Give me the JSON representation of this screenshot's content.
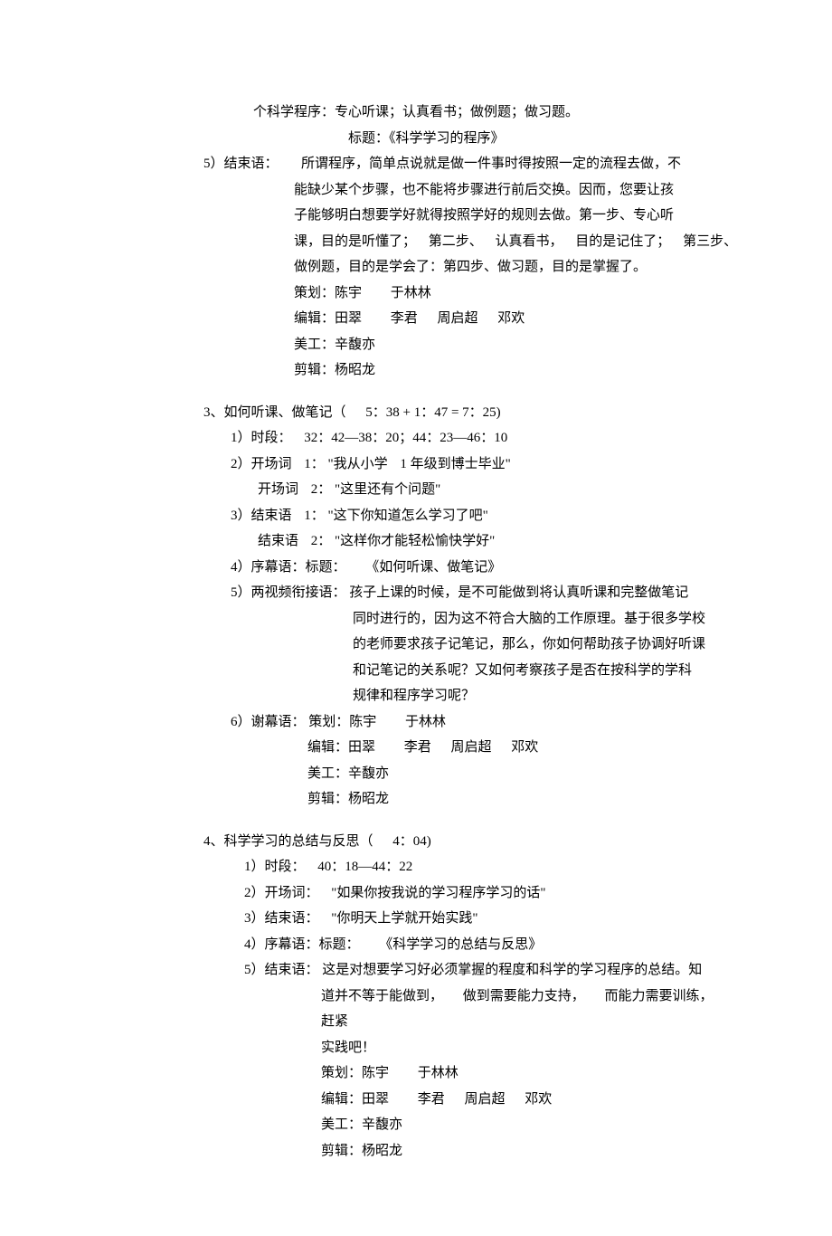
{
  "intro": {
    "cont_line": "个科学程序：专心听课；认真看书；做例题；做习题。",
    "title_label": "标题：《科学学习的程序》"
  },
  "block_end5": {
    "label": "5）结束语：",
    "l1": "所谓程序，简单点说就是做一件事时得按照一定的流程去做，不",
    "l2": "能缺少某个步骤，也不能将步骤进行前后交换。因而，您要让孩",
    "l3": "子能够明白想要学好就得按照学好的规则去做。第一步、专心听",
    "l4a": "课，目的是听懂了；",
    "l4b": "第二步、",
    "l4c": "认真看书，",
    "l4d": "目的是记住了；",
    "l4e": "第三步、",
    "l5": "做例题，目的是学会了：第四步、做习题，目的是掌握了。"
  },
  "credits": {
    "plan_label": "策划：陈宇",
    "plan_name2": "于林林",
    "edit_label": "编辑：田翠",
    "edit2": "李君",
    "edit3": "周启超",
    "edit4": "邓欢",
    "art_label": "美工：辛馥亦",
    "cut_label": "剪辑：杨昭龙"
  },
  "sec3": {
    "head": "3、如何听课、做笔记（",
    "head_time": "5：38 + 1：47 = 7：25)",
    "i1_label": "1）时段：",
    "i1_val": "32：42—38：20；44：23—46：10",
    "i2a_label": "2）开场词",
    "i2a_num": "1：",
    "i2a_val": "\"我从小学",
    "i2a_val2": "1 年级到博士毕业\"",
    "i2b_label": "开场词",
    "i2b_num": "2：",
    "i2b_val": "\"这里还有个问题\"",
    "i3a_label": "3）结束语",
    "i3a_num": "1：",
    "i3a_val": "\"这下你知道怎么学习了吧\"",
    "i3b_label": "结束语",
    "i3b_num": "2：",
    "i3b_val": "\"这样你才能轻松愉快学好\"",
    "i4_label": "4）序幕语：标题：",
    "i4_val": "《如何听课、做笔记》",
    "i5_label": "5）两视频衔接语：",
    "i5_l1": "孩子上课的时候，是不可能做到将认真听课和完整做笔记",
    "i5_l2": "同时进行的，因为这不符合大脑的工作原理。基于很多学校",
    "i5_l3": "的老师要求孩子记笔记，那么，你如何帮助孩子协调好听课",
    "i5_l4": "和记笔记的关系呢？又如何考察孩子是否在按科学的学科",
    "i5_l5": "规律和程序学习呢？",
    "i6_label": "6）谢幕语："
  },
  "sec4": {
    "head": "4、科学学习的总结与反思（",
    "head_time": "4：04)",
    "i1_label": "1）时段：",
    "i1_val": "40：18—44：22",
    "i2_label": "2）开场词：",
    "i2_val": "\"如果你按我说的学习程序学习的话\"",
    "i3_label": "3）结束语：",
    "i3_val": "\"你明天上学就开始实践\"",
    "i4_label": "4）序幕语：标题：",
    "i4_val": "《科学学习的总结与反思》",
    "i5_label": "5）结束语：",
    "i5_l1": "这是对想要学习好必须掌握的程度和科学的学习程序的总结。知",
    "i5_l2a": "道并不等于能做到，",
    "i5_l2b": "做到需要能力支持，",
    "i5_l2c": "而能力需要训练，",
    "i5_l2d": "赶紧",
    "i5_l3": "实践吧！"
  }
}
